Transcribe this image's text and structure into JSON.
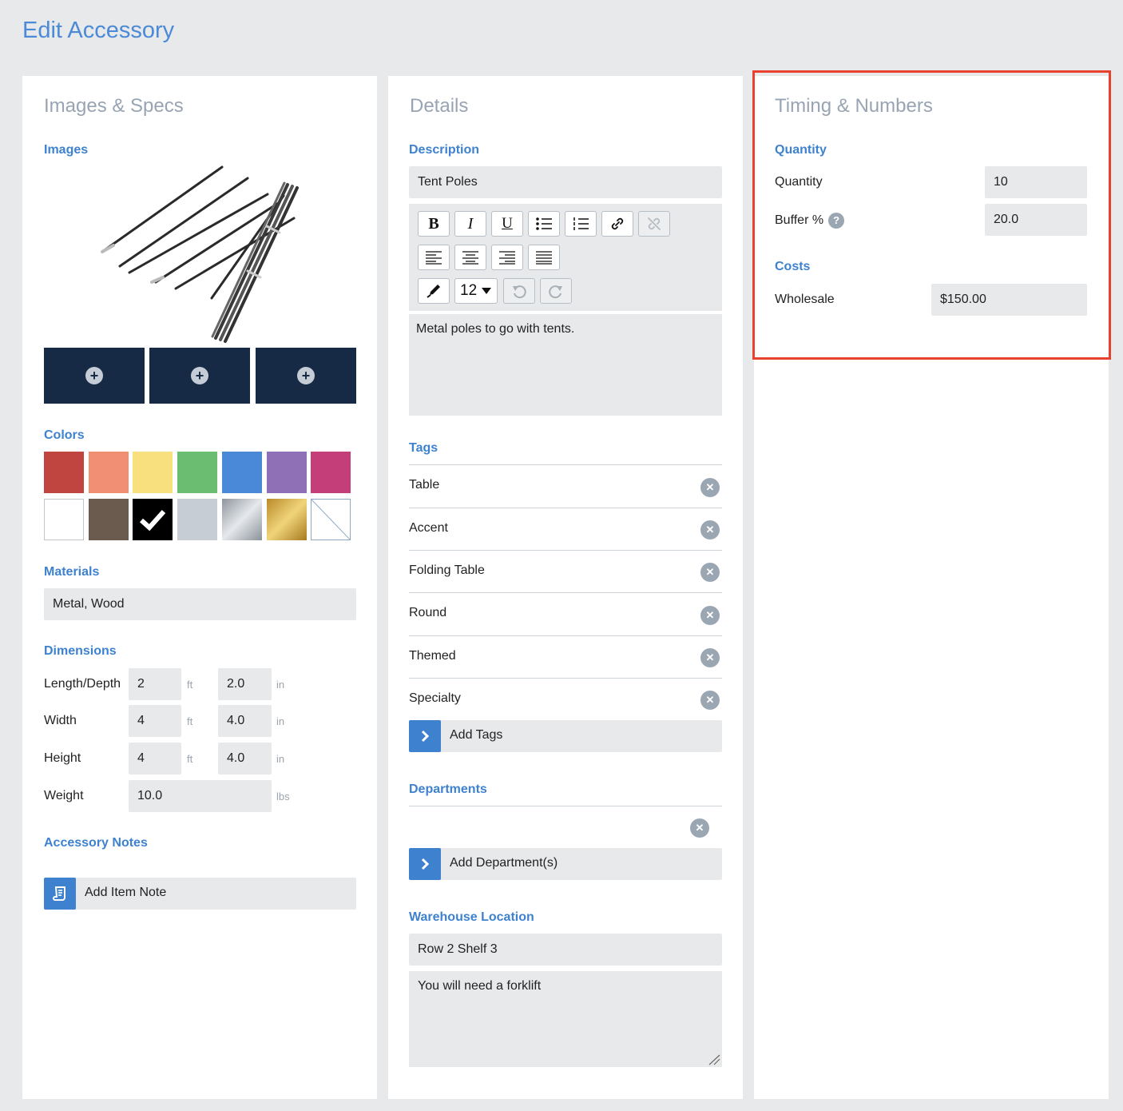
{
  "page_title": "Edit Accessory",
  "images_specs": {
    "title": "Images & Specs",
    "images_label": "Images",
    "add_image_symbol": "+",
    "colors_label": "Colors",
    "colors_row1": [
      "#c0443f",
      "#f08f73",
      "#f9e07e",
      "#6bbd72",
      "#4a88d8",
      "#8f6fb5",
      "#c43f7a"
    ],
    "colors_row2": [
      "#ffffff",
      "#6b5a4e",
      "#000000",
      "#c7cdd4",
      "silver-gradient",
      "gold-gradient",
      "none"
    ],
    "selected_color_index": 9,
    "materials_label": "Materials",
    "materials_value": "Metal, Wood",
    "dimensions_label": "Dimensions",
    "dimensions": {
      "length_label": "Length/Depth",
      "length_ft": "2",
      "length_in": "2.0",
      "width_label": "Width",
      "width_ft": "4",
      "width_in": "4.0",
      "height_label": "Height",
      "height_ft": "4",
      "height_in": "4.0",
      "weight_label": "Weight",
      "weight_value": "10.0",
      "unit_ft": "ft",
      "unit_in": "in",
      "unit_lbs": "lbs"
    },
    "notes_label": "Accessory Notes",
    "add_note_label": "Add Item Note"
  },
  "details": {
    "title": "Details",
    "description_label": "Description",
    "description_value": "Tent Poles",
    "toolbar": {
      "bold": "B",
      "italic": "I",
      "underline": "U",
      "font_size": "12"
    },
    "body_text": "Metal poles to go with tents.",
    "tags_label": "Tags",
    "tags": [
      "Table",
      "Accent",
      "Folding Table",
      "Round",
      "Themed",
      "Specialty"
    ],
    "add_tags_label": "Add Tags",
    "departments_label": "Departments",
    "add_departments_label": "Add Department(s)",
    "warehouse_label": "Warehouse Location",
    "warehouse_value": "Row 2 Shelf 3",
    "warehouse_notes": "You will need a forklift"
  },
  "timing": {
    "title": "Timing & Numbers",
    "quantity_section": "Quantity",
    "quantity_label": "Quantity",
    "quantity_value": "10",
    "buffer_label": "Buffer %",
    "buffer_value": "20.0",
    "help_symbol": "?",
    "costs_section": "Costs",
    "wholesale_label": "Wholesale",
    "wholesale_value": "$150.00"
  },
  "colors": {
    "accent": "#3e82cf",
    "navy": "#172a45",
    "highlight": "#e8422f"
  },
  "icons": [
    "plus-icon",
    "check-icon",
    "bold-icon",
    "italic-icon",
    "underline-icon",
    "bullet-list-icon",
    "numbered-list-icon",
    "link-icon",
    "unlink-icon",
    "align-left-icon",
    "align-center-icon",
    "align-right-icon",
    "justify-icon",
    "pen-icon",
    "undo-icon",
    "redo-icon",
    "remove-icon",
    "chevron-right-icon",
    "note-icon",
    "help-icon"
  ]
}
